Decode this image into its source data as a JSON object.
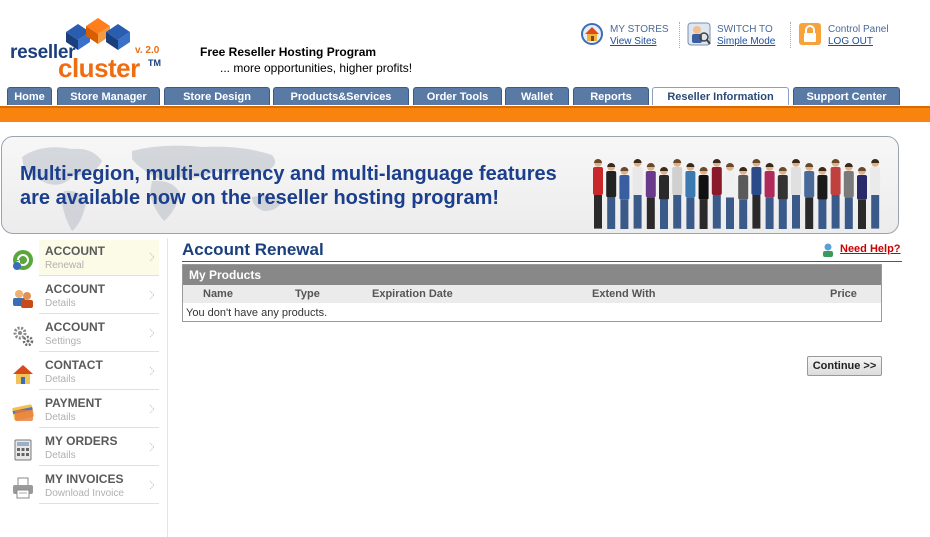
{
  "logo": {
    "word1": "reseller",
    "word2": "cluster",
    "tm": "TM",
    "version": "v. 2.0"
  },
  "tagline": {
    "title": "Free Reseller Hosting Program",
    "subtitle": "... more opportunities, higher profits!"
  },
  "top_links": [
    {
      "title": "MY STORES",
      "link": "View Sites",
      "icon": "home-icon"
    },
    {
      "title": "SWITCH TO",
      "link": "Simple Mode",
      "icon": "switch-mode-icon"
    },
    {
      "title": "Control Panel",
      "link": "LOG OUT",
      "icon": "lock-icon"
    }
  ],
  "tabs": [
    "Home",
    "Store Manager",
    "Store Design",
    "Products&Services",
    "Order Tools",
    "Wallet",
    "Reports",
    "Reseller Information",
    "Support Center"
  ],
  "active_tab": "Reseller Information",
  "banner": {
    "line1": "Multi-region, multi-currency and multi-language features",
    "line2": "are available now on the reseller hosting program!"
  },
  "sidebar": {
    "items": [
      {
        "title": "ACCOUNT",
        "sub": "Renewal",
        "icon": "account-renewal-icon",
        "active": true
      },
      {
        "title": "ACCOUNT",
        "sub": "Details",
        "icon": "account-details-icon"
      },
      {
        "title": "ACCOUNT",
        "sub": "Settings",
        "icon": "gears-icon"
      },
      {
        "title": "CONTACT",
        "sub": "Details",
        "icon": "contact-house-icon"
      },
      {
        "title": "PAYMENT",
        "sub": "Details",
        "icon": "credit-card-icon"
      },
      {
        "title": "MY ORDERS",
        "sub": "Details",
        "icon": "calculator-icon"
      },
      {
        "title": "MY INVOICES",
        "sub": "Download Invoice",
        "icon": "invoice-printer-icon"
      }
    ]
  },
  "main": {
    "title": "Account Renewal",
    "help_label": "Need Help?",
    "products": {
      "heading": "My Products",
      "columns": [
        "Name",
        "Type",
        "Expiration Date",
        "Extend With",
        "Price"
      ],
      "empty_message": "You don't have any products."
    },
    "continue_label": "Continue >>"
  },
  "colors": {
    "tab_blue": "#5a7aa6",
    "orange_bar": "#f8830f",
    "title_blue": "#1b3f7c",
    "help_red": "#cc0000"
  }
}
